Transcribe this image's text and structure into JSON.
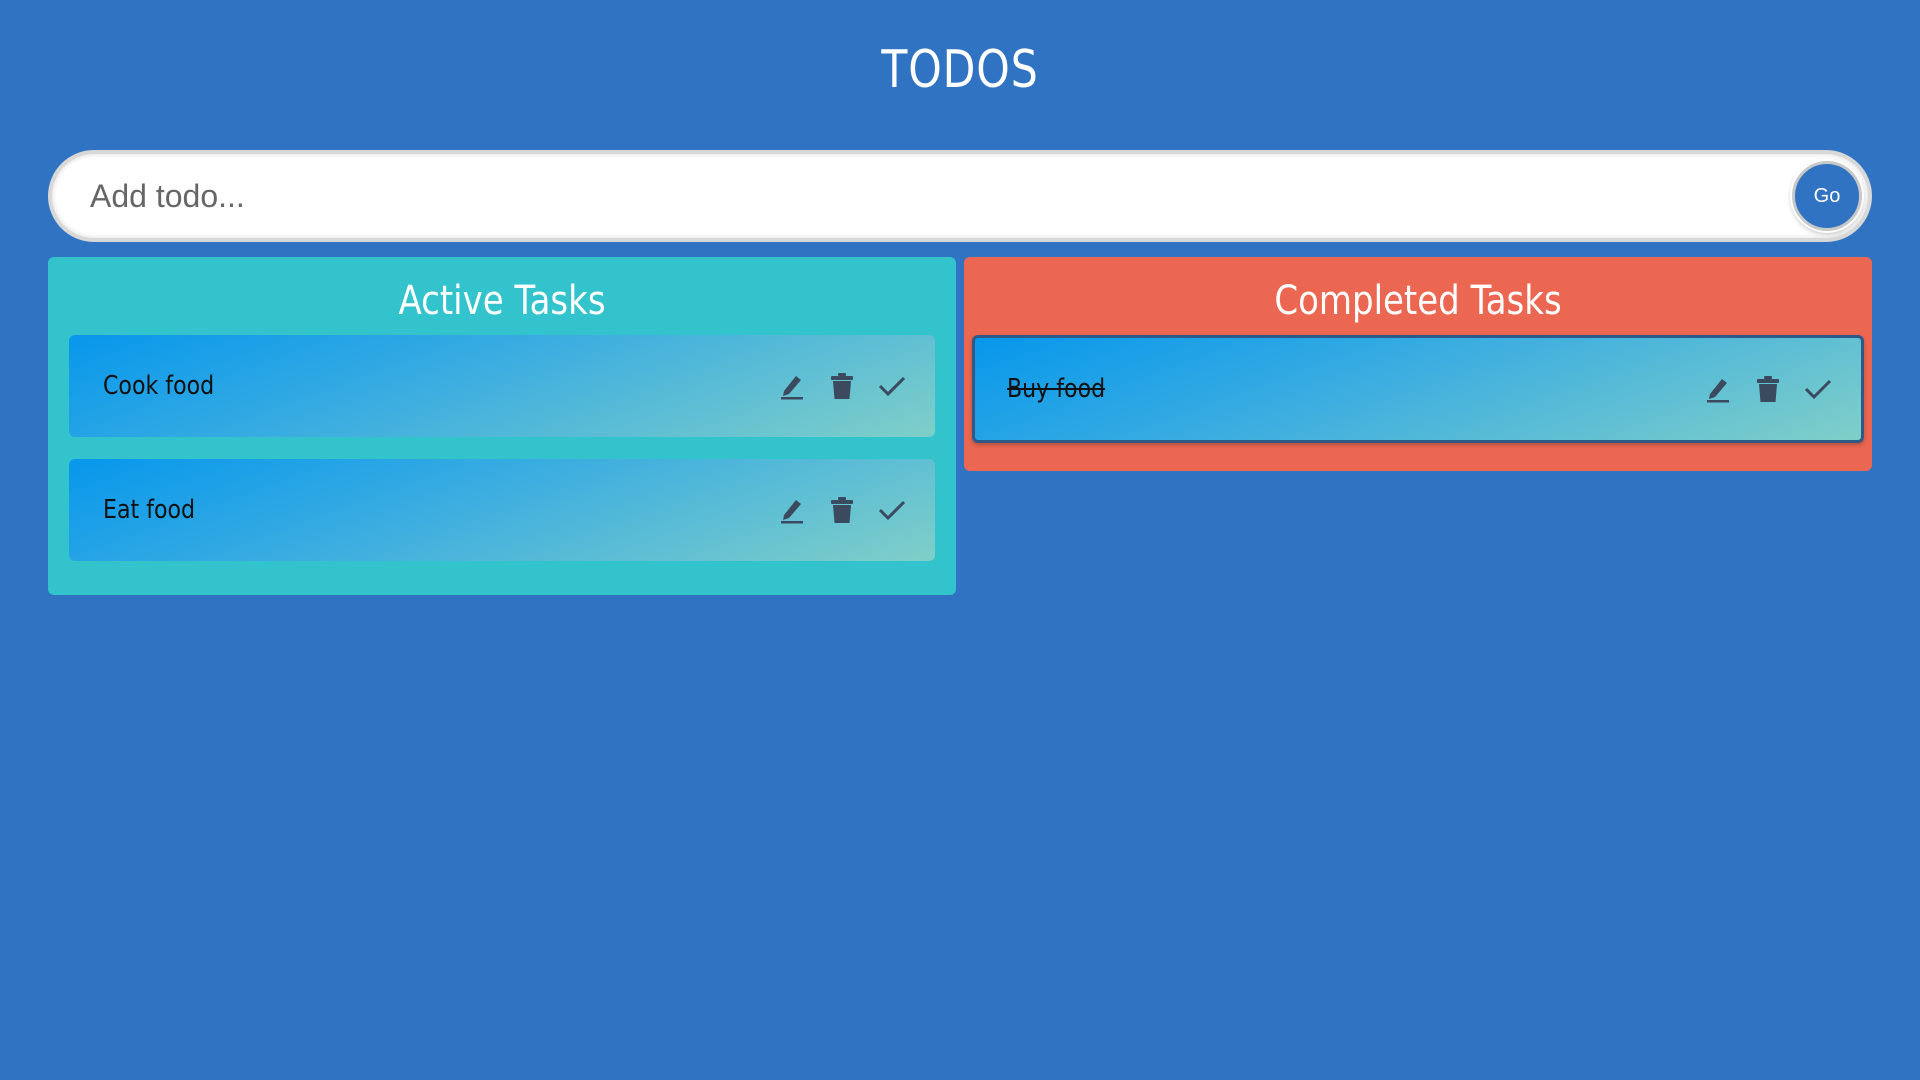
{
  "header": {
    "title": "TODOS"
  },
  "add_todo": {
    "placeholder": "Add todo...",
    "value": "",
    "submit_label": "Go"
  },
  "active": {
    "title": "Active Tasks",
    "tasks": [
      {
        "label": "Cook food"
      },
      {
        "label": "Eat food"
      }
    ]
  },
  "completed": {
    "title": "Completed Tasks",
    "tasks": [
      {
        "label": "Buy food"
      }
    ]
  },
  "icons": {
    "edit": "pencil-icon",
    "delete": "trash-icon",
    "complete": "checkmark-icon"
  },
  "colors": {
    "background": "#2f73c2",
    "active_panel": "#33c3cd",
    "completed_panel": "#ec6752",
    "icon": "#3b4a5e"
  }
}
